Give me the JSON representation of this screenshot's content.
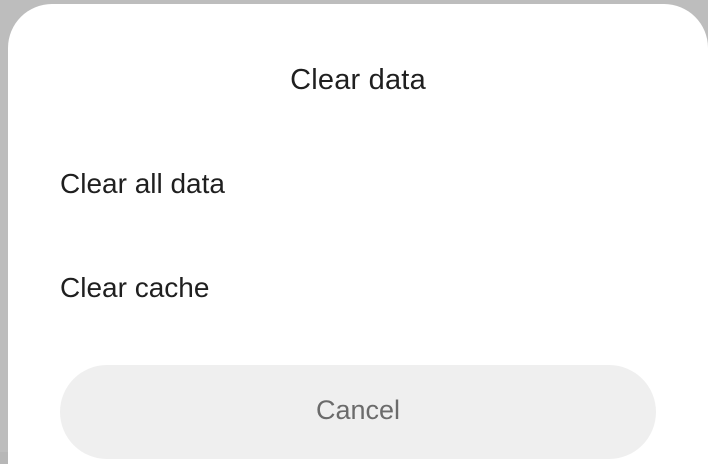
{
  "dialog": {
    "title": "Clear data",
    "options": [
      {
        "label": "Clear all data"
      },
      {
        "label": "Clear cache"
      }
    ],
    "cancel_label": "Cancel"
  }
}
